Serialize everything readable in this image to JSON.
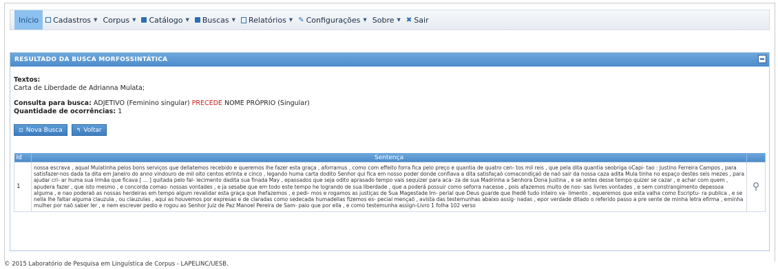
{
  "menu": [
    {
      "label": "Início",
      "icon": "",
      "caret": false,
      "active": true,
      "name": "menu-inicio"
    },
    {
      "label": "Cadastros",
      "icon": "grid-icon",
      "caret": true,
      "name": "menu-cadastros"
    },
    {
      "label": "Corpus",
      "icon": "",
      "caret": true,
      "name": "menu-corpus"
    },
    {
      "label": "Catálogo",
      "icon": "square-icon",
      "caret": true,
      "name": "menu-catalogo"
    },
    {
      "label": "Buscas",
      "icon": "square-icon",
      "caret": true,
      "name": "menu-buscas"
    },
    {
      "label": "Relatórios",
      "icon": "document-icon",
      "caret": true,
      "name": "menu-relatorios"
    },
    {
      "label": "Configurações",
      "icon": "wrench-icon",
      "caret": true,
      "name": "menu-configuracoes"
    },
    {
      "label": "Sobre",
      "icon": "",
      "caret": true,
      "name": "menu-sobre"
    },
    {
      "label": "Sair",
      "icon": "close-icon",
      "caret": false,
      "name": "menu-sair"
    }
  ],
  "panel": {
    "title": "RESULTADO DA BUSCA MORFOSSINTÁTICA",
    "textos_label": "Textos:",
    "textos_value": "Carta de Liberdade de Adrianna Mulata;",
    "consulta_label": "Consulta para busca:",
    "consulta_pre": "ADJETIVO (Feminino singular)",
    "consulta_op": "PRECEDE",
    "consulta_post": "NOME PRÓPRIO (Singular)",
    "quantidade_label": "Quantidade de ocorrências:",
    "quantidade_value": "1"
  },
  "buttons": {
    "nova_busca": "Nova Busca",
    "voltar": "Voltar"
  },
  "table": {
    "headers": [
      "Id",
      "Sentença"
    ],
    "rows": [
      {
        "id": "1",
        "sentence": "nossa escrava , aqual Mulatinha pelos bons serviços que dellatemos recebido e queremos lhe fazer esta graça , aforramus , como com effeito forra fica pelo preço e quantia de quatro cen- tos mil reis , que pela dita quantia seobriga oCapi- tao : Justino Ferreira Campos , para satisfazer-nos dada ta dita em Janeiro do anno vindouro de mil oito centos etrinta e cinco , legando huma carta dodito Senhor qui fica em nosso poder donde confiava a dita satisfaçaõ comacondiçaõ de naõ sair da nossa caza adita Mula tinha no espaço destes seis mezes , para ajudar cri- ar huma sua Irmãa que ficava [ ... ] quitada pelo fal- lecimento dadita sua finada May , epassados que seja odito aprasado tempo vais sequizer para aca- za de sua Madrinha a Senhora Dona Justina , e se antes desse tempo quizer se cazar , e achar com quem , apudera fazer , que isto mesmo , e concorda comas- nossas vontades , e ja sesabe que em todo este tempo he logrando de sua liberdade , que a poderá possuir como seforra nacesse , pois afazemos muito de nos- sas livres vontades , e sem constrangimento depessoa alguma , e nao poderaõ as nossas herdeiras em tempo algum revalidar esta graça que lhefazemos , e pedi- mos e rogamos as justiças de Sua Magestade Im- perial que Deus guarde que lhedê tudo inteiro va- limento , equeremos que esta valha como Escriptu- ra publica , e se nella lhe faltar alguma clauzula , ou clauzulas , aqui as houvemos por expresas e de claradas como sedecada humadellas fizemos es- pecial mençaõ , avista das testemunhas abaixo assig- nadas , epor verdade ditado o referido passo a pre sente de minha letra efirma , eminha mulher por naõ saber ler , e nem escrever pedio e rogou ao Senhor Juiz de Paz Manoel Pereira de Sam- paio que por ella , e como testemunha assign-Livro 1 folha 102 verso"
      }
    ]
  },
  "footer": "© 2015 Laboratório de Pesquisa em Linguística de Corpus - LAPELINC/UESB."
}
